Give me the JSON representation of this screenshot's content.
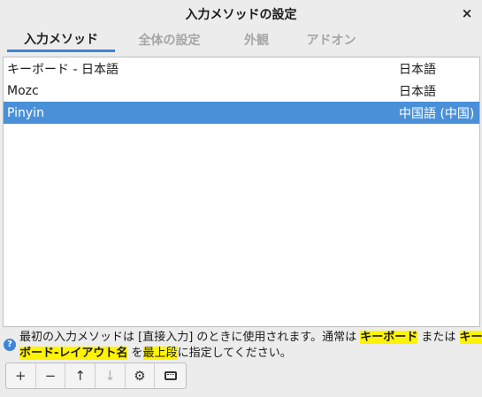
{
  "window": {
    "title": "入力メソッドの設定",
    "close_label": "×"
  },
  "tabs": [
    {
      "label": "入力メソッド",
      "active": true
    },
    {
      "label": "全体の設定",
      "active": false
    },
    {
      "label": "外観",
      "active": false
    },
    {
      "label": "アドオン",
      "active": false
    }
  ],
  "methods": [
    {
      "name": "キーボード - 日本語",
      "language": "日本語",
      "selected": false
    },
    {
      "name": "Mozc",
      "language": "日本語",
      "selected": false
    },
    {
      "name": "Pinyin",
      "language": "中国語 (中国)",
      "selected": true
    }
  ],
  "hint": {
    "icon": "?",
    "part1": "最初の入力メソッドは [直接入力] のときに使用されます。通常は ",
    "hl1": "キーボード",
    "part2": " または ",
    "hl2": "キーボード-レイアウト名",
    "part3": " を",
    "hl3": "最上段",
    "part4": "に指定してください。"
  },
  "toolbar": {
    "add": "+",
    "remove": "−",
    "up": "↑",
    "down": "↓",
    "configure": "⚙"
  },
  "icons": {
    "close": "close-icon",
    "help": "help-icon",
    "keyboard": "keyboard-icon"
  },
  "colors": {
    "accent": "#3d84d6",
    "selection": "#4a90d9",
    "highlight": "#fff300"
  }
}
